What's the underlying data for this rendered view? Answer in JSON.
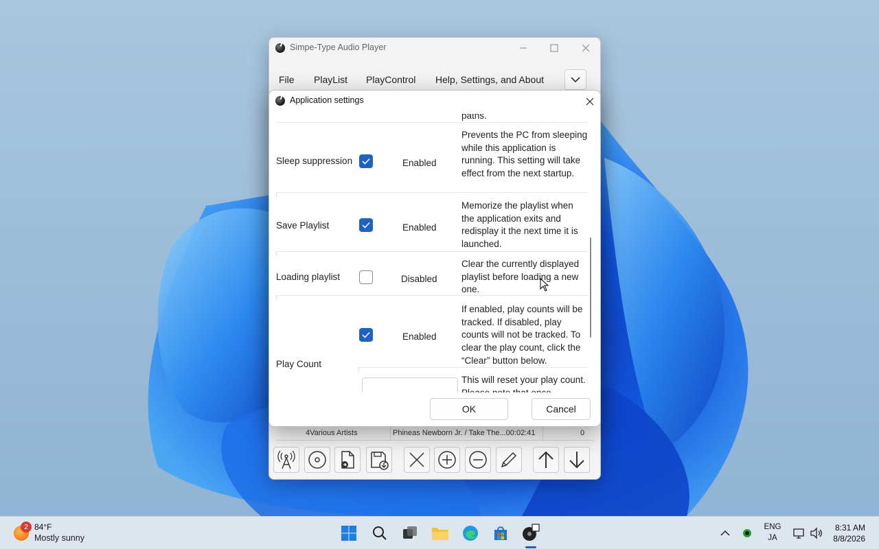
{
  "main_window": {
    "title": "Simpe-Type Audio Player",
    "menu": [
      "File",
      "PlayList",
      "PlayControl",
      "Help, Settings, and About"
    ],
    "track": {
      "number_artist": "4Various Artists",
      "title_duration": "Phineas Newborn Jr. / Take The...00:02:41",
      "count": "0"
    },
    "toolbar_icons": [
      "radio-tower-icon",
      "disc-icon",
      "open-file-icon",
      "save-file-icon",
      "remove-icon",
      "add-icon",
      "minus-icon",
      "edit-pencil-icon",
      "move-up-icon",
      "move-down-icon"
    ]
  },
  "dialog": {
    "title": "Application settings",
    "partial_top_text": "paths.",
    "settings": [
      {
        "name": "Sleep suppression",
        "checked": true,
        "state": "Enabled",
        "description": "Prevents the PC from sleeping while this application is running. This setting will take effect from the next startup."
      },
      {
        "name": "Save Playlist",
        "checked": true,
        "state": "Enabled",
        "description": "Memorize the playlist when the application exits and redisplay it the next time it is launched."
      },
      {
        "name": "Loading playlist",
        "checked": false,
        "state": "Disabled",
        "description": "Clear the currently displayed playlist before loading a new one."
      },
      {
        "name": "Play Count",
        "checked": true,
        "state": "Enabled",
        "description": "If enabled, play counts will be tracked. If disabled, play counts will not be tracked. To clear the play count, click the “Clear” button below.",
        "sub_description": "This will reset your play count. Please note that once"
      }
    ],
    "ok_label": "OK",
    "cancel_label": "Cancel"
  },
  "taskbar": {
    "weather_badge": "2",
    "weather_temp": "84°F",
    "weather_cond": "Mostly sunny",
    "lang_top": "ENG",
    "lang_bottom": "JA",
    "time": "8:31 AM",
    "date": "8/8/2026"
  },
  "colors": {
    "accent": "#1f62c6",
    "wallpaper": "#9dbdd8",
    "taskbar": "#dde5ee"
  }
}
